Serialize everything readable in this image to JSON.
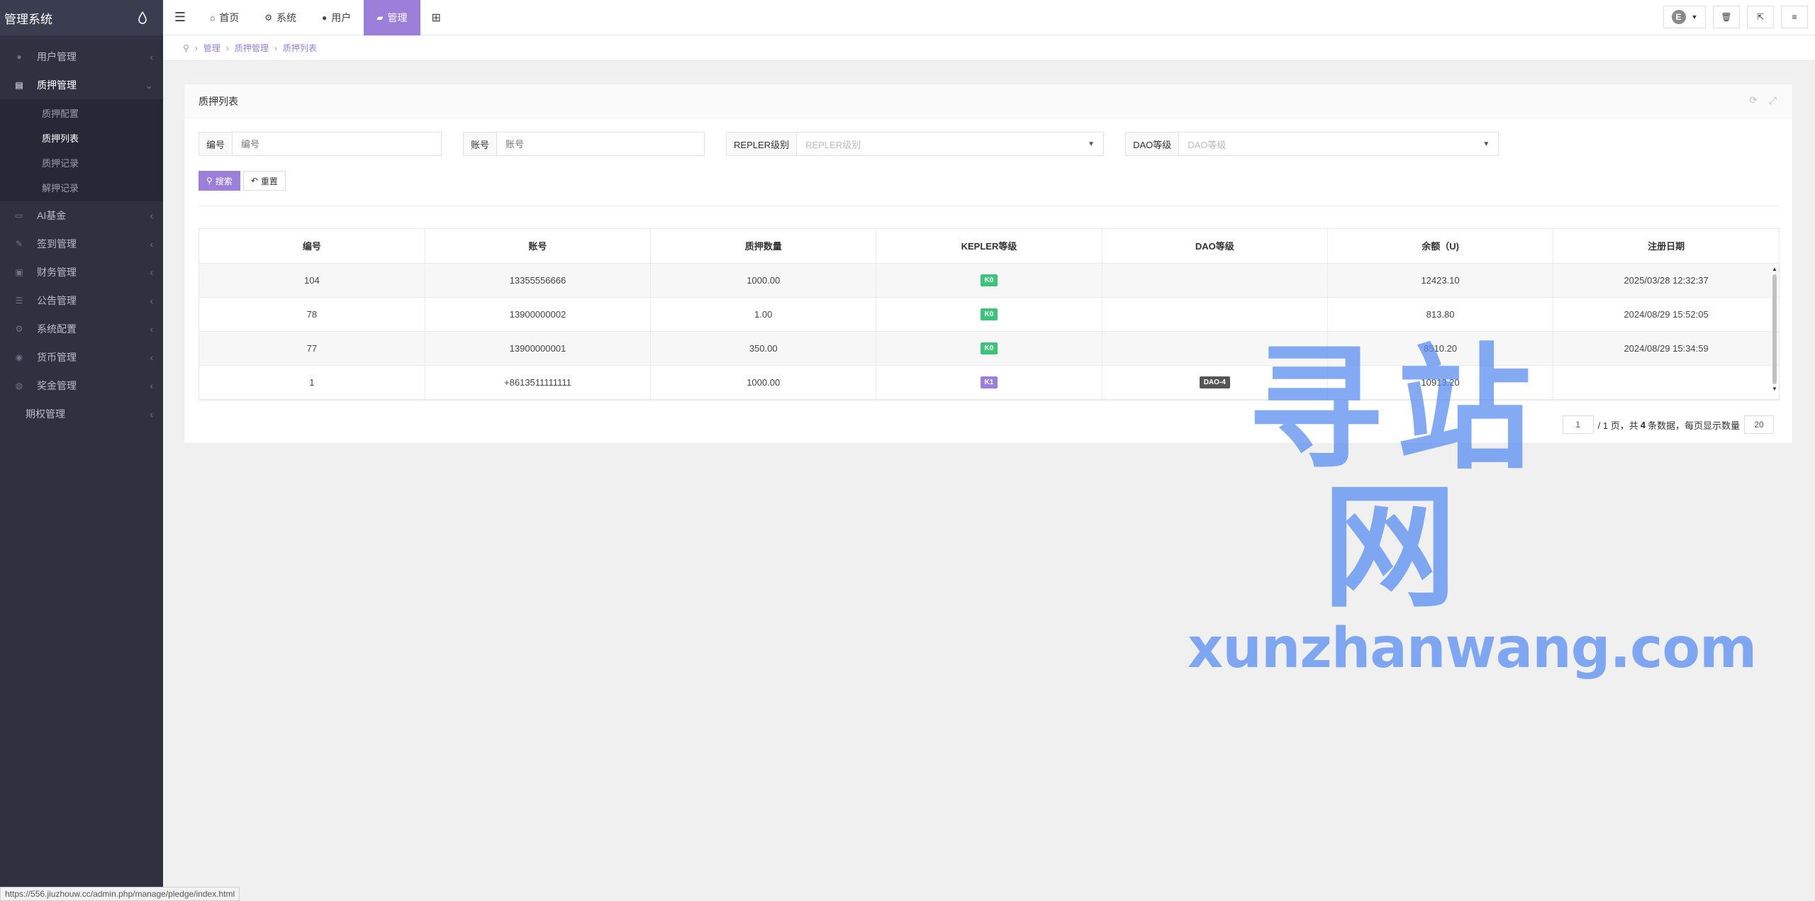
{
  "brand": {
    "title": "管理系统"
  },
  "sidebar": {
    "items": [
      {
        "label": "用户管理",
        "icon": "user-icon"
      },
      {
        "label": "质押管理",
        "icon": "table-icon",
        "active": true,
        "children": [
          "质押配置",
          "质押列表",
          "质押记录",
          "解押记录"
        ],
        "current": "质押列表"
      },
      {
        "label": "AI基金",
        "icon": "monitor-icon"
      },
      {
        "label": "签到管理",
        "icon": "edit-icon"
      },
      {
        "label": "财务管理",
        "icon": "money-icon"
      },
      {
        "label": "公告管理",
        "icon": "list-icon"
      },
      {
        "label": "系统配置",
        "icon": "cogs-icon"
      },
      {
        "label": "货币管理",
        "icon": "coin-icon"
      },
      {
        "label": "奖金管理",
        "icon": "gift-icon"
      },
      {
        "label": "期权管理",
        "icon": ""
      }
    ]
  },
  "topbar": {
    "tabs": [
      {
        "label": "首页",
        "icon": "home-icon"
      },
      {
        "label": "系统",
        "icon": "gear-icon"
      },
      {
        "label": "用户",
        "icon": "user-icon"
      },
      {
        "label": "管理",
        "icon": "briefcase-icon",
        "active": true
      }
    ],
    "avatar_letter": "E"
  },
  "breadcrumb": [
    "管理",
    "质押管理",
    "质押列表"
  ],
  "panel": {
    "title": "质押列表",
    "filters": {
      "id_label": "编号",
      "id_placeholder": "编号",
      "account_label": "账号",
      "account_placeholder": "账号",
      "repler_label": "REPLER级别",
      "repler_placeholder": "REPLER级别",
      "dao_label": "DAO等级",
      "dao_placeholder": "DAO等级"
    },
    "search_label": "搜索",
    "reset_label": "重置"
  },
  "table": {
    "columns": [
      "编号",
      "账号",
      "质押数量",
      "KEPLER等级",
      "DAO等级",
      "余额（U)",
      "注册日期"
    ],
    "rows": [
      {
        "id": "104",
        "account": "13355556666",
        "amount": "1000.00",
        "kepler": "K0",
        "dao": "",
        "balance": "12423.10",
        "date": "2025/03/28 12:32:37"
      },
      {
        "id": "78",
        "account": "13900000002",
        "amount": "1.00",
        "kepler": "K0",
        "dao": "",
        "balance": "813.80",
        "date": "2024/08/29 15:52:05"
      },
      {
        "id": "77",
        "account": "13900000001",
        "amount": "350.00",
        "kepler": "K0",
        "dao": "",
        "balance": "8510.20",
        "date": "2024/08/29 15:34:59"
      },
      {
        "id": "1",
        "account": "+8613511111111",
        "amount": "1000.00",
        "kepler": "K1",
        "dao": "DAO-4",
        "balance": "10913.20",
        "date": ""
      }
    ]
  },
  "pager": {
    "page": "1",
    "text_pages": "/ 1 页，共",
    "total": "4",
    "text_records": "条数据，每页显示数量",
    "page_size": "20"
  },
  "watermark": {
    "big": "寻站网",
    "small": "xunzhanwang.com"
  },
  "status_url": "https://556.jiuzhouw.cc/admin.php/manage/pledge/index.html"
}
